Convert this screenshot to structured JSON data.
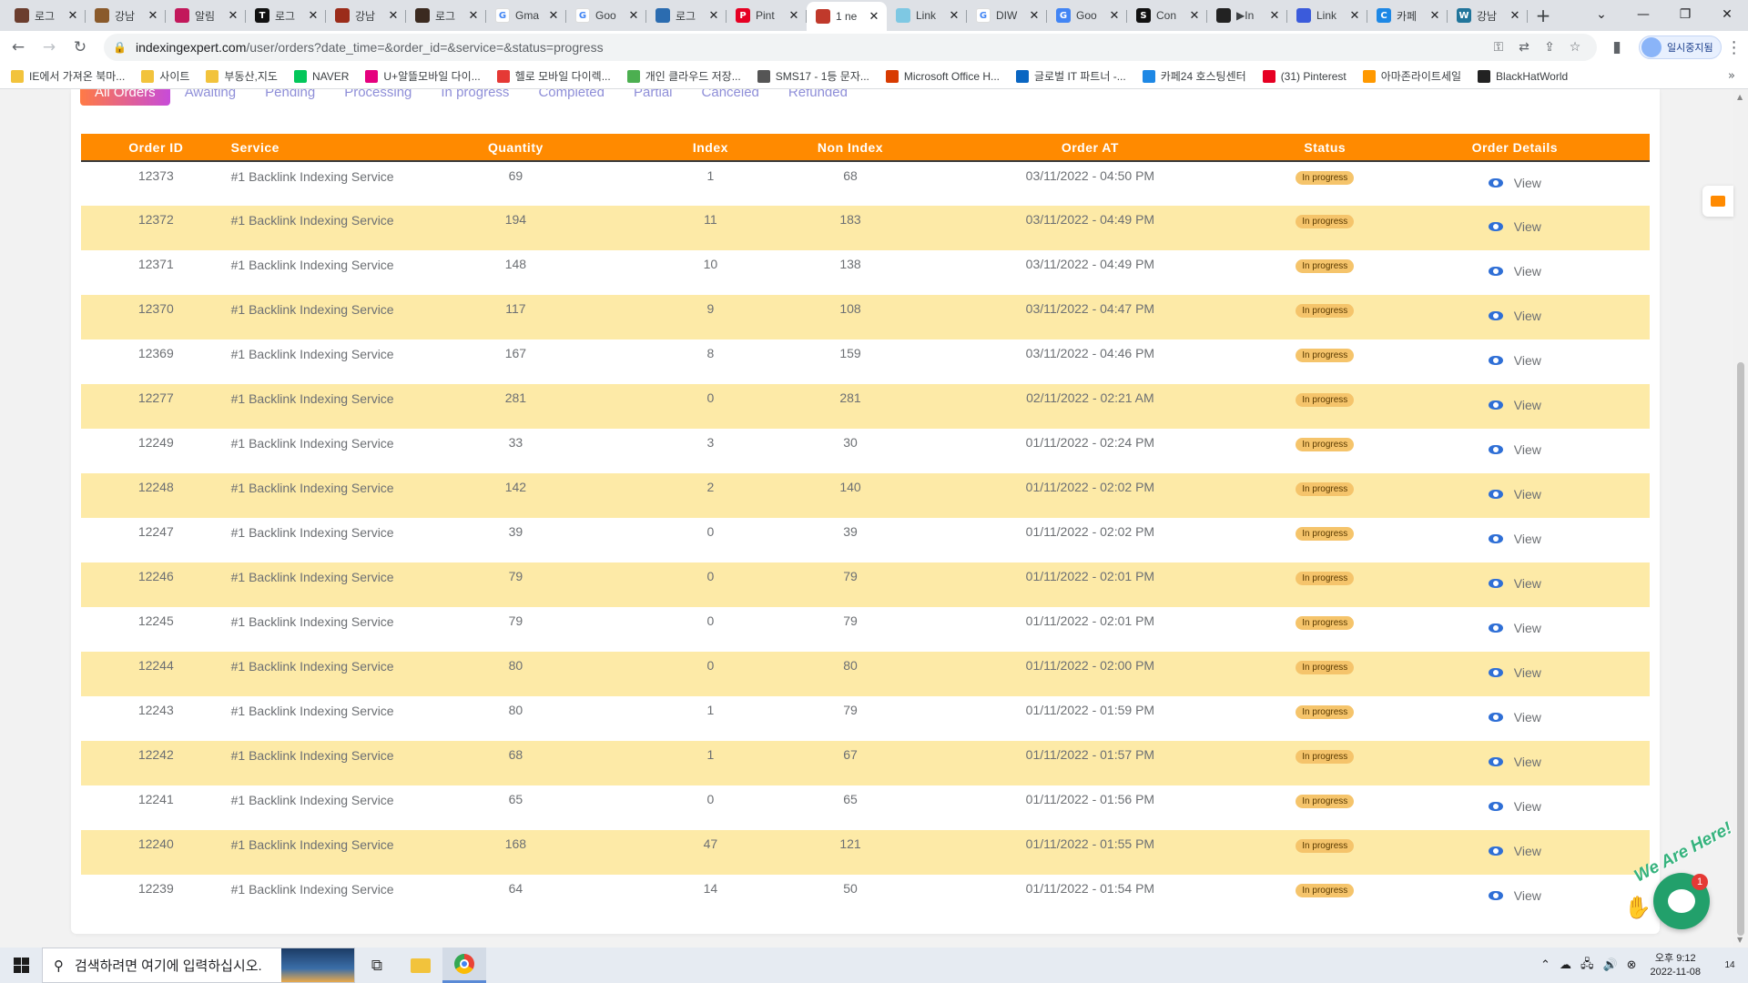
{
  "browser": {
    "tabs": [
      {
        "title": "로그",
        "icon": "site-favicon",
        "color": "#6b3d2e",
        "glyph": ""
      },
      {
        "title": "강남",
        "icon": "site-favicon",
        "color": "#8a5a2b",
        "glyph": ""
      },
      {
        "title": "알림",
        "icon": "site-favicon",
        "color": "#c2185b",
        "glyph": ""
      },
      {
        "title": "로그",
        "icon": "site-favicon",
        "color": "#111111",
        "glyph": "T"
      },
      {
        "title": "강남",
        "icon": "site-favicon",
        "color": "#9b2c1a",
        "glyph": ""
      },
      {
        "title": "로그",
        "icon": "site-favicon",
        "color": "#3b2a20",
        "glyph": ""
      },
      {
        "title": "Gma",
        "icon": "google-favicon",
        "color": "#ffffff",
        "glyph": "G"
      },
      {
        "title": "Goo",
        "icon": "google-favicon",
        "color": "#ffffff",
        "glyph": "G"
      },
      {
        "title": "로그",
        "icon": "site-favicon",
        "color": "#2b6cb0",
        "glyph": ""
      },
      {
        "title": "Pint",
        "icon": "pinterest-favicon",
        "color": "#e60023",
        "glyph": "P"
      },
      {
        "title": "1 ne",
        "icon": "site-favicon",
        "color": "#c0392b",
        "glyph": ""
      },
      {
        "title": "Link",
        "icon": "site-favicon",
        "color": "#7ec8e3",
        "glyph": ""
      },
      {
        "title": "DIW",
        "icon": "google-favicon",
        "color": "#ffffff",
        "glyph": "G"
      },
      {
        "title": "Goo",
        "icon": "translate-favicon",
        "color": "#4285f4",
        "glyph": "G"
      },
      {
        "title": "Con",
        "icon": "site-favicon",
        "color": "#111111",
        "glyph": "S"
      },
      {
        "title": "▶In",
        "icon": "site-favicon",
        "color": "#222222",
        "glyph": ""
      },
      {
        "title": "Link",
        "icon": "site-favicon",
        "color": "#3b5bdb",
        "glyph": ""
      },
      {
        "title": "카페",
        "icon": "site-favicon",
        "color": "#1e88e5",
        "glyph": "C"
      },
      {
        "title": "강남",
        "icon": "wordpress-favicon",
        "color": "#21759b",
        "glyph": "W"
      }
    ],
    "url_host": "indexingexpert.com",
    "url_path": "/user/orders?date_time=&order_id=&service=&status=progress",
    "profile_label": "일시중지됨",
    "bookmarks": [
      {
        "label": "IE에서 가져온 북마...",
        "color": "#f2c33c"
      },
      {
        "label": "사이트",
        "color": "#f2c33c"
      },
      {
        "label": "부동산,지도",
        "color": "#f2c33c"
      },
      {
        "label": "NAVER",
        "color": "#03c75a"
      },
      {
        "label": "U+알뜰모바일 다이...",
        "color": "#e5007e"
      },
      {
        "label": "헬로 모바일 다이렉...",
        "color": "#e53935"
      },
      {
        "label": "개인 클라우드 저장...",
        "color": "#4caf50"
      },
      {
        "label": "SMS17 - 1등 문자...",
        "color": "#555555"
      },
      {
        "label": "Microsoft Office H...",
        "color": "#d83b01"
      },
      {
        "label": "글로벌 IT 파트너 -...",
        "color": "#0a66c2"
      },
      {
        "label": "카페24 호스팅센터",
        "color": "#1e88e5"
      },
      {
        "label": "(31) Pinterest",
        "color": "#e60023"
      },
      {
        "label": "아마존라이트세일",
        "color": "#ff9900"
      },
      {
        "label": "BlackHatWorld",
        "color": "#222222"
      }
    ]
  },
  "page": {
    "filter_tabs": [
      "All Orders",
      "Awaiting",
      "Pending",
      "Processing",
      "In progress",
      "Completed",
      "Partial",
      "Canceled",
      "Refunded"
    ],
    "table": {
      "headers": [
        "Order ID",
        "Service",
        "Quantity",
        "Index",
        "Non Index",
        "Order AT",
        "Status",
        "Order Details"
      ],
      "view_label": "View",
      "rows": [
        {
          "id": "12373",
          "service": "#1 Backlink Indexing Service",
          "quantity": "69",
          "index": "1",
          "non_index": "68",
          "order_at": "03/11/2022 - 04:50 PM",
          "status": "In progress"
        },
        {
          "id": "12372",
          "service": "#1 Backlink Indexing Service",
          "quantity": "194",
          "index": "11",
          "non_index": "183",
          "order_at": "03/11/2022 - 04:49 PM",
          "status": "In progress"
        },
        {
          "id": "12371",
          "service": "#1 Backlink Indexing Service",
          "quantity": "148",
          "index": "10",
          "non_index": "138",
          "order_at": "03/11/2022 - 04:49 PM",
          "status": "In progress"
        },
        {
          "id": "12370",
          "service": "#1 Backlink Indexing Service",
          "quantity": "117",
          "index": "9",
          "non_index": "108",
          "order_at": "03/11/2022 - 04:47 PM",
          "status": "In progress"
        },
        {
          "id": "12369",
          "service": "#1 Backlink Indexing Service",
          "quantity": "167",
          "index": "8",
          "non_index": "159",
          "order_at": "03/11/2022 - 04:46 PM",
          "status": "In progress"
        },
        {
          "id": "12277",
          "service": "#1 Backlink Indexing Service",
          "quantity": "281",
          "index": "0",
          "non_index": "281",
          "order_at": "02/11/2022 - 02:21 AM",
          "status": "In progress"
        },
        {
          "id": "12249",
          "service": "#1 Backlink Indexing Service",
          "quantity": "33",
          "index": "3",
          "non_index": "30",
          "order_at": "01/11/2022 - 02:24 PM",
          "status": "In progress"
        },
        {
          "id": "12248",
          "service": "#1 Backlink Indexing Service",
          "quantity": "142",
          "index": "2",
          "non_index": "140",
          "order_at": "01/11/2022 - 02:02 PM",
          "status": "In progress"
        },
        {
          "id": "12247",
          "service": "#1 Backlink Indexing Service",
          "quantity": "39",
          "index": "0",
          "non_index": "39",
          "order_at": "01/11/2022 - 02:02 PM",
          "status": "In progress"
        },
        {
          "id": "12246",
          "service": "#1 Backlink Indexing Service",
          "quantity": "79",
          "index": "0",
          "non_index": "79",
          "order_at": "01/11/2022 - 02:01 PM",
          "status": "In progress"
        },
        {
          "id": "12245",
          "service": "#1 Backlink Indexing Service",
          "quantity": "79",
          "index": "0",
          "non_index": "79",
          "order_at": "01/11/2022 - 02:01 PM",
          "status": "In progress"
        },
        {
          "id": "12244",
          "service": "#1 Backlink Indexing Service",
          "quantity": "80",
          "index": "0",
          "non_index": "80",
          "order_at": "01/11/2022 - 02:00 PM",
          "status": "In progress"
        },
        {
          "id": "12243",
          "service": "#1 Backlink Indexing Service",
          "quantity": "80",
          "index": "1",
          "non_index": "79",
          "order_at": "01/11/2022 - 01:59 PM",
          "status": "In progress"
        },
        {
          "id": "12242",
          "service": "#1 Backlink Indexing Service",
          "quantity": "68",
          "index": "1",
          "non_index": "67",
          "order_at": "01/11/2022 - 01:57 PM",
          "status": "In progress"
        },
        {
          "id": "12241",
          "service": "#1 Backlink Indexing Service",
          "quantity": "65",
          "index": "0",
          "non_index": "65",
          "order_at": "01/11/2022 - 01:56 PM",
          "status": "In progress"
        },
        {
          "id": "12240",
          "service": "#1 Backlink Indexing Service",
          "quantity": "168",
          "index": "47",
          "non_index": "121",
          "order_at": "01/11/2022 - 01:55 PM",
          "status": "In progress"
        },
        {
          "id": "12239",
          "service": "#1 Backlink Indexing Service",
          "quantity": "64",
          "index": "14",
          "non_index": "50",
          "order_at": "01/11/2022 - 01:54 PM",
          "status": "In progress"
        }
      ]
    },
    "chat": {
      "banner": "We Are Here!",
      "badge": "1"
    }
  },
  "taskbar": {
    "search_placeholder": "검색하려면 여기에 입력하십시오.",
    "time": "오후 9:12",
    "date": "2022-11-08",
    "notification_count": "14"
  },
  "colors": {
    "accent": "#ff8a00",
    "row_alt": "#fdeaa7",
    "badge": "#f5c46b",
    "chat": "#22a06b"
  }
}
